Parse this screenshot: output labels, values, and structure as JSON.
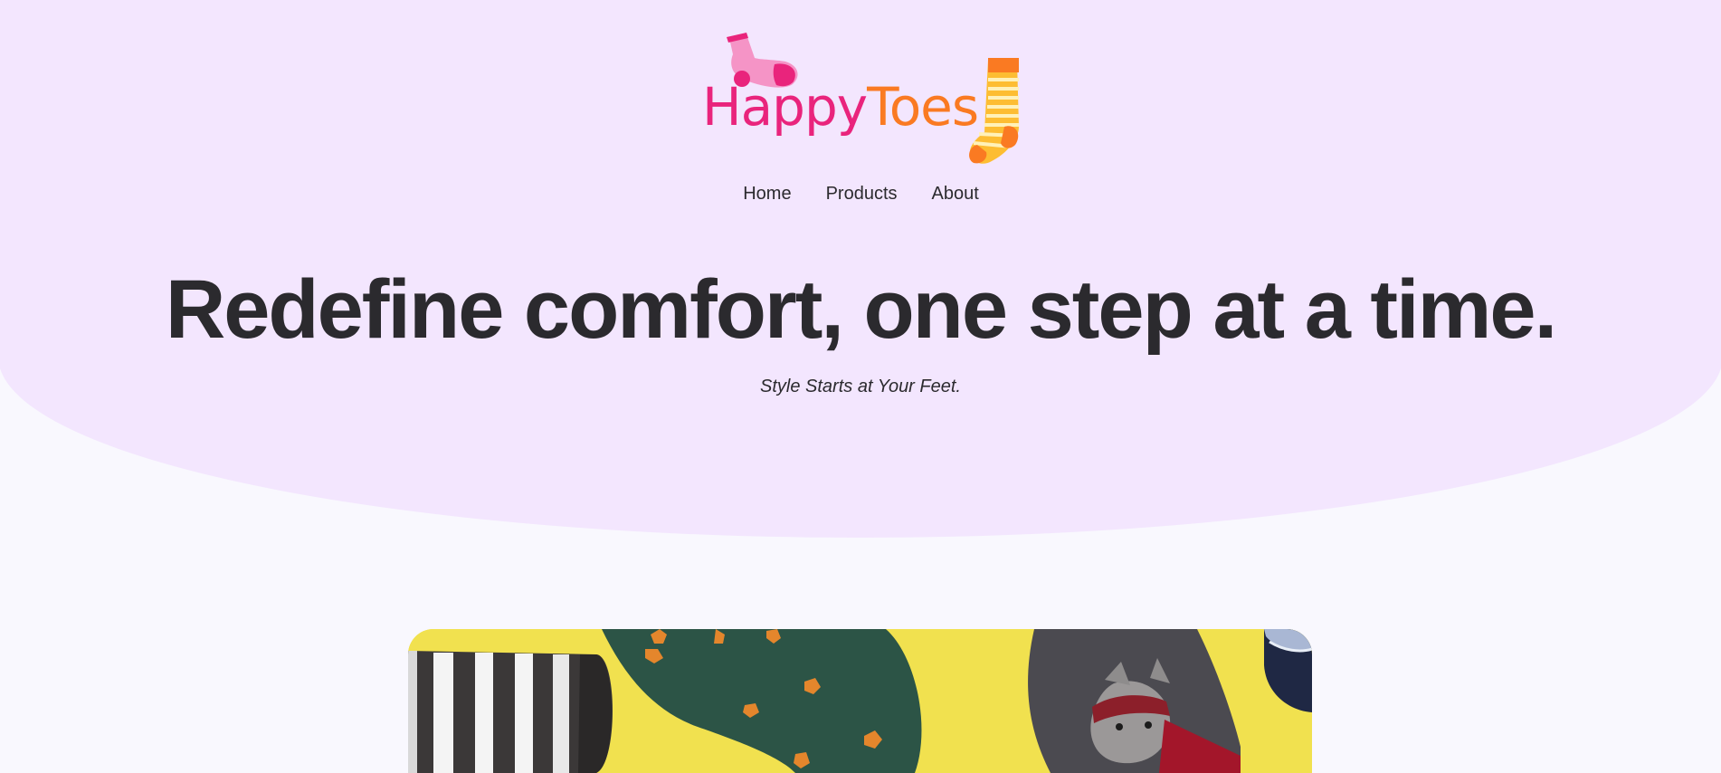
{
  "brand": {
    "name_part1": "Happy",
    "name_part2": "Toes",
    "colors": {
      "pink": "#e9247c",
      "orange": "#fa7a22",
      "sock_yellow": "#fdbd32"
    },
    "icons": [
      "pink-sock-icon",
      "striped-sock-icon"
    ]
  },
  "nav": {
    "items": [
      {
        "label": "Home"
      },
      {
        "label": "Products"
      },
      {
        "label": "About"
      }
    ]
  },
  "hero": {
    "headline": "Redefine comfort, one step at a time.",
    "tagline": "Style Starts at Your Feet.",
    "background": "#f3e6fe"
  },
  "page": {
    "background": "#f9f8fe"
  },
  "featured_image": {
    "subject": "colorful patterned socks on a yellow surface",
    "background": "#f1e14f"
  }
}
